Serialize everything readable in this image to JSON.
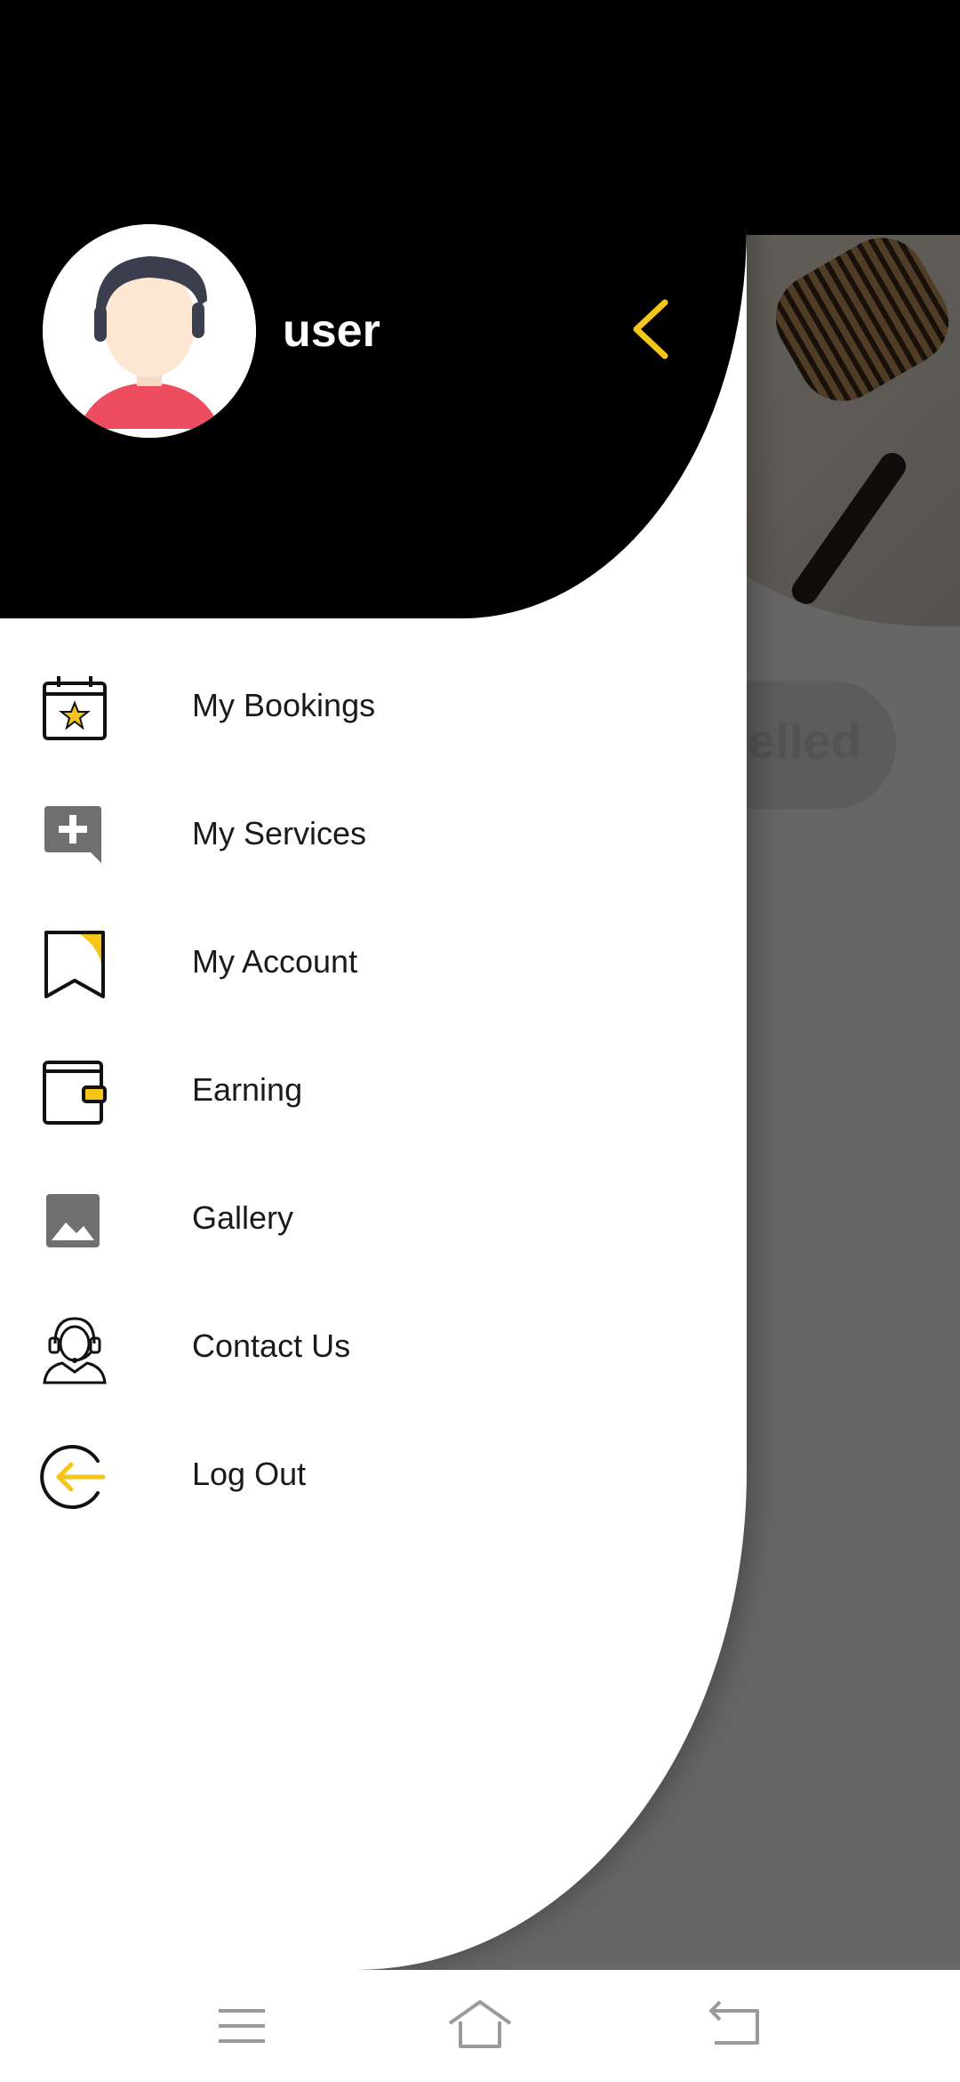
{
  "background_app": {
    "status_pill_fragment": "celled"
  },
  "drawer": {
    "user_name": "user",
    "menu": [
      {
        "label": "My Bookings",
        "icon": "calendar-star-icon"
      },
      {
        "label": "My Services",
        "icon": "add-comment-icon"
      },
      {
        "label": "My Account",
        "icon": "bookmark-icon"
      },
      {
        "label": "Earning",
        "icon": "wallet-icon"
      },
      {
        "label": "Gallery",
        "icon": "image-icon"
      },
      {
        "label": "Contact Us",
        "icon": "support-agent-icon"
      },
      {
        "label": "Log Out",
        "icon": "logout-icon"
      }
    ]
  },
  "navbar": {
    "buttons": [
      "menu-icon",
      "home-icon",
      "back-icon"
    ]
  },
  "colors": {
    "accent": "#F5C518",
    "header_bg": "#000000",
    "drawer_bg": "#FFFFFF",
    "scrim": "rgba(0,0,0,0.6)"
  }
}
